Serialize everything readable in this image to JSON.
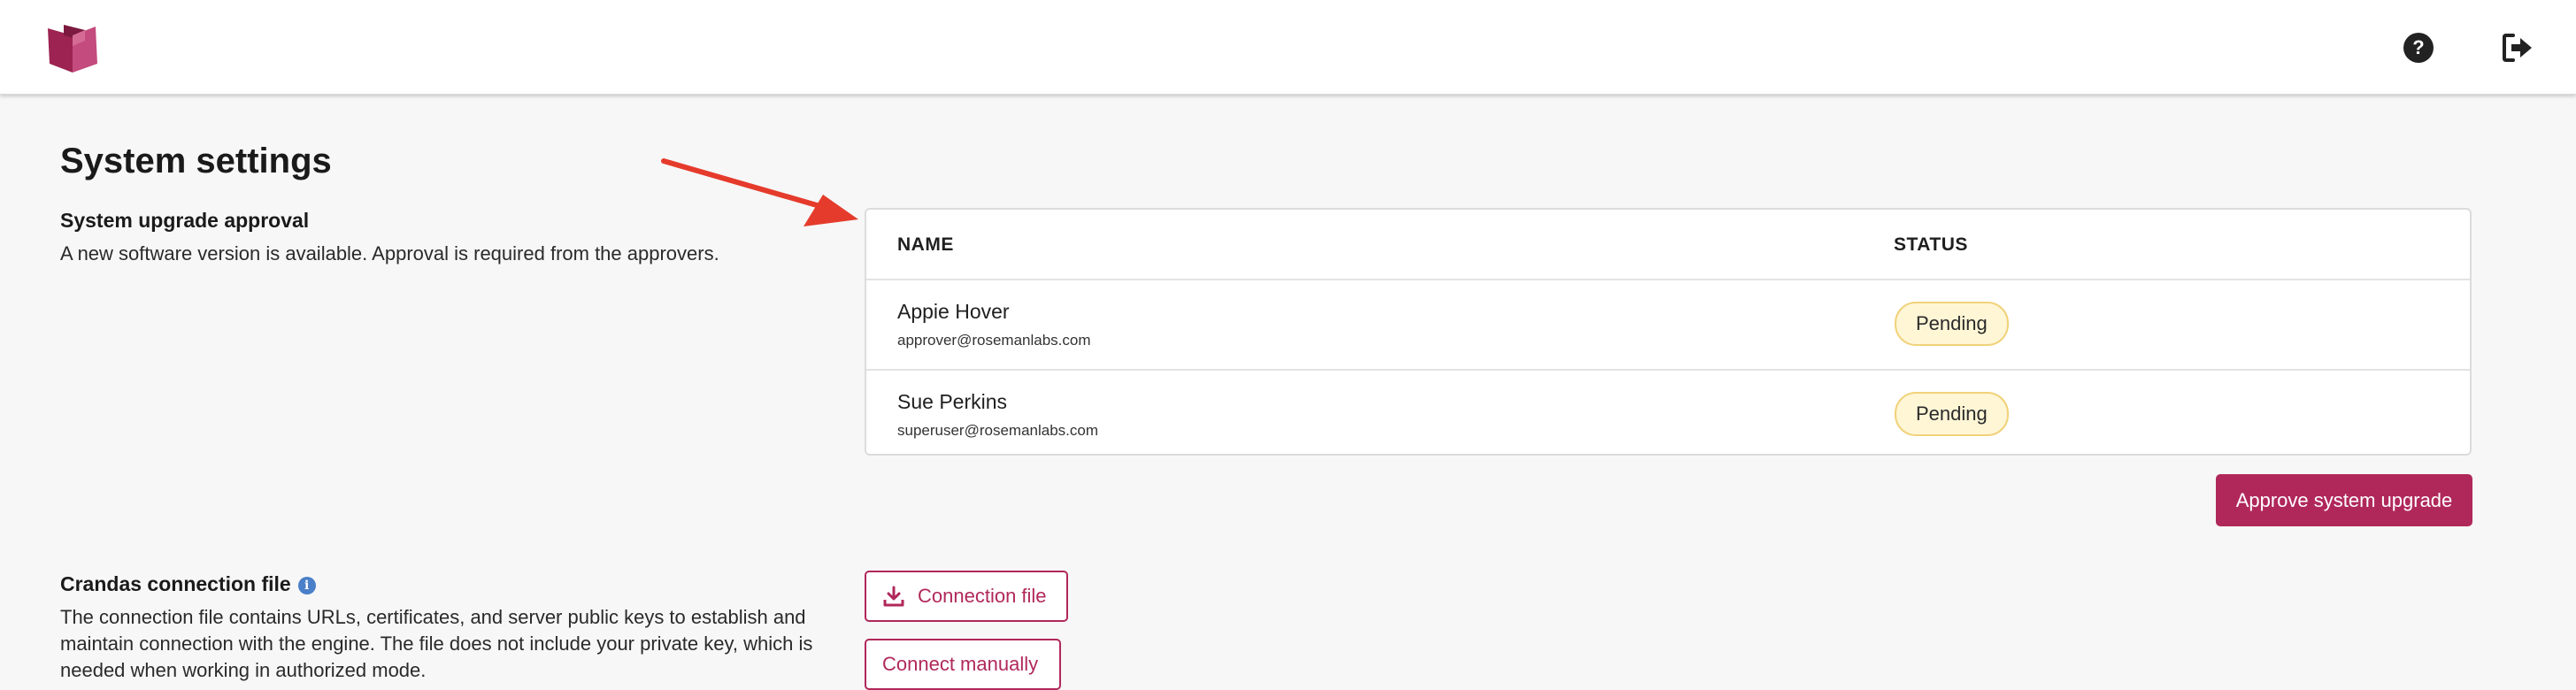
{
  "colors": {
    "brand": "#b0285a",
    "badge_bg": "#fff6d6",
    "badge_border": "#f1d27a",
    "annotation_arrow": "#e53b2c"
  },
  "header": {
    "logo_icon": "book-logo-icon",
    "help_icon": "help-circle-icon",
    "logout_icon": "logout-icon"
  },
  "page": {
    "title": "System settings"
  },
  "upgrade": {
    "title": "System upgrade approval",
    "description": "A new software version is available. Approval is required from the approvers.",
    "table": {
      "headers": [
        "NAME",
        "STATUS"
      ],
      "rows": [
        {
          "name": "Appie Hover",
          "email": "approver@rosemanlabs.com",
          "status": "Pending"
        },
        {
          "name": "Sue Perkins",
          "email": "superuser@rosemanlabs.com",
          "status": "Pending"
        }
      ]
    },
    "approve_button": "Approve system upgrade"
  },
  "connection": {
    "title": "Crandas connection file",
    "info_icon": "i",
    "description_lines": [
      "The connection file contains URLs, certificates, and server public keys to establish and",
      "maintain connection with the engine. The file does not include your private key, which is",
      "needed when working in authorized mode."
    ],
    "file_button": "Connection file",
    "manual_button": "Connect manually"
  }
}
